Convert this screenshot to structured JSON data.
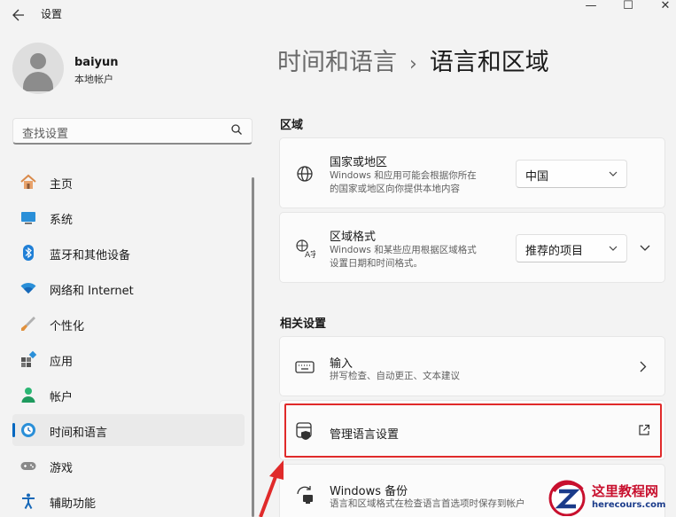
{
  "window": {
    "title": "设置",
    "back_icon": "back-arrow-icon",
    "min_glyph": "—",
    "max_glyph": "☐",
    "close_glyph": "✕"
  },
  "user": {
    "name": "baiyun",
    "account_type": "本地帐户"
  },
  "search": {
    "placeholder": "查找设置",
    "icon": "search-icon"
  },
  "nav": {
    "items": [
      {
        "label": "主页",
        "icon": "home-icon"
      },
      {
        "label": "系统",
        "icon": "display-icon"
      },
      {
        "label": "蓝牙和其他设备",
        "icon": "bluetooth-icon"
      },
      {
        "label": "网络和 Internet",
        "icon": "wifi-icon"
      },
      {
        "label": "个性化",
        "icon": "paintbrush-icon"
      },
      {
        "label": "应用",
        "icon": "apps-icon"
      },
      {
        "label": "帐户",
        "icon": "account-icon"
      },
      {
        "label": "时间和语言",
        "icon": "globe-clock-icon",
        "active": true
      },
      {
        "label": "游戏",
        "icon": "gamepad-icon"
      },
      {
        "label": "辅助功能",
        "icon": "accessibility-icon"
      }
    ]
  },
  "breadcrumb": {
    "parent": "时间和语言",
    "separator": "›",
    "current": "语言和区域"
  },
  "region_section": {
    "title": "区域",
    "country": {
      "title": "国家或地区",
      "desc_line1": "Windows 和应用可能会根据你所在",
      "desc_line2": "的国家或地区向你提供本地内容",
      "value": "中国",
      "icon": "globe-icon"
    },
    "format": {
      "title": "区域格式",
      "desc_line1": "Windows 和某些应用根据区域格式",
      "desc_line2": "设置日期和时间格式。",
      "value": "推荐的项目",
      "icon": "regional-format-icon"
    }
  },
  "related_section": {
    "title": "相关设置",
    "input": {
      "title": "输入",
      "desc": "拼写检查、自动更正、文本建议",
      "icon": "keyboard-icon"
    },
    "admin_language": {
      "title": "管理语言设置",
      "icon": "shield-window-icon"
    },
    "backup": {
      "title": "Windows 备份",
      "desc": "语言和区域格式在检查语言首选项时保存到帐户",
      "icon": "backup-sync-icon"
    }
  },
  "watermark": {
    "title": "这里教程网",
    "url": "herecours.com"
  },
  "colors": {
    "accent": "#0067c0",
    "highlight": "#e02a2a",
    "background": "#f3f3f3",
    "card": "#fbfbfb"
  }
}
